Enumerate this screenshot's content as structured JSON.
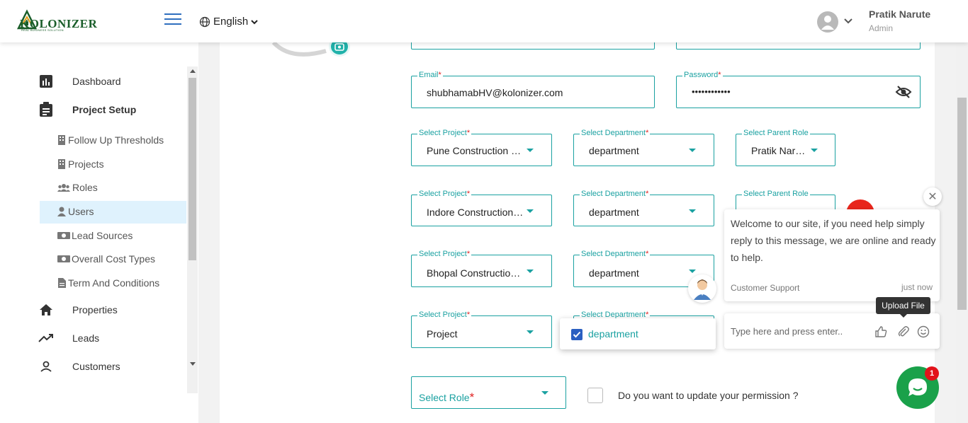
{
  "header": {
    "logo_text": "KOLONIZER",
    "logo_subtext": "REAL BUSINESS SOLUTION",
    "language": "English",
    "user_name": "Pratik Narute",
    "user_role": "Admin"
  },
  "sidebar": {
    "main_items": [
      {
        "label": "Dashboard",
        "icon": "bar-chart-icon"
      },
      {
        "label": "Project Setup",
        "icon": "clipboard-icon"
      }
    ],
    "sub_items": [
      {
        "label": "Follow Up Thresholds",
        "icon": "building-icon"
      },
      {
        "label": "Projects",
        "icon": "building-icon"
      },
      {
        "label": "Roles",
        "icon": "users-icon"
      },
      {
        "label": "Users",
        "icon": "user-icon",
        "active": true
      },
      {
        "label": "Lead Sources",
        "icon": "money-icon"
      },
      {
        "label": "Overall Cost Types",
        "icon": "money-icon"
      },
      {
        "label": "Term And Conditions",
        "icon": "document-icon"
      }
    ],
    "bottom_items": [
      {
        "label": "Properties",
        "icon": "home-icon"
      },
      {
        "label": "Leads",
        "icon": "trending-icon"
      },
      {
        "label": "Customers",
        "icon": "person-icon"
      }
    ]
  },
  "form": {
    "email": {
      "label": "Email",
      "value": "shubhamabHV@kolonizer.com"
    },
    "password": {
      "label": "Password",
      "value": "••••••••••••"
    },
    "rows": [
      {
        "project": "Pune Construction a…",
        "department": "department",
        "parent_role": "Pratik Naru…"
      },
      {
        "project": "Indore Construction …",
        "department": "department",
        "parent_role": ""
      },
      {
        "project": "Bhopal Construction…",
        "department": "department",
        "parent_role": null
      },
      {
        "project": "Project",
        "department": "",
        "parent_role": null
      }
    ],
    "labels": {
      "select_project": "Select Project",
      "select_department": "Select Department",
      "select_parent_role": "Select Parent Role",
      "required_mark": "*"
    },
    "select_role": "Select Role",
    "permission_question": "Do you want to update your permission ?",
    "dropdown_option": "department"
  },
  "chat": {
    "message": "Welcome to our site, if you need help simply reply to this message, we are online and ready to help.",
    "agent": "Customer Support",
    "time": "just now",
    "input_placeholder": "Type here and press enter..",
    "tooltip": "Upload File",
    "badge_count": "1",
    "close_symbol": "✕"
  },
  "colors": {
    "accent": "#1aa1a1",
    "active_bg": "#dff2fd",
    "launcher": "#1aa14a",
    "badge": "#e2121a"
  }
}
